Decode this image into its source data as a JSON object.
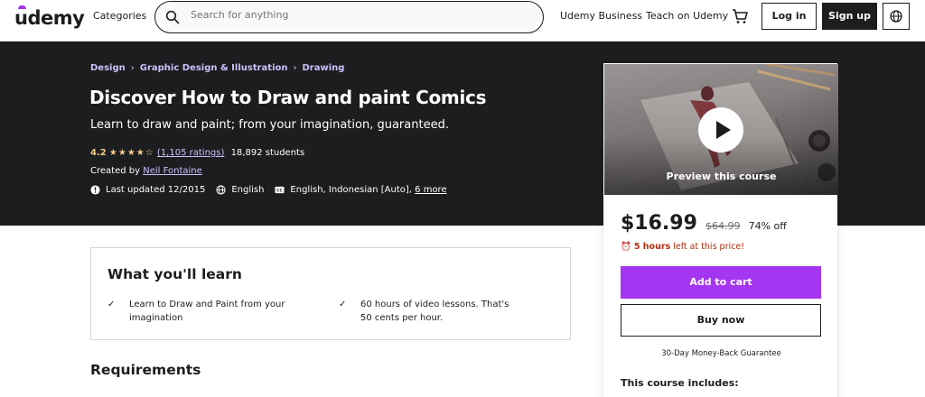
{
  "header": {
    "logo": "udemy",
    "categories": "Categories",
    "search_placeholder": "Search for anything",
    "business": "Udemy Business",
    "teach": "Teach on Udemy",
    "login": "Log in",
    "signup": "Sign up"
  },
  "breadcrumb": [
    "Design",
    "Graphic Design & Illustration",
    "Drawing"
  ],
  "course": {
    "title": "Discover How to Draw and paint Comics",
    "subtitle": "Learn to draw and paint; from your imagination, guaranteed.",
    "rating": "4.2",
    "stars": "★★★★☆",
    "ratings_count": "(1,105 ratings)",
    "students": "18,892 students",
    "created_by_label": "Created by",
    "instructor": "Neil Fontaine",
    "last_updated": "Last updated 12/2015",
    "language": "English",
    "captions": "English, Indonesian [Auto],",
    "more_captions": "6 more"
  },
  "card": {
    "preview_label": "Preview this course",
    "price": "$16.99",
    "original_price": "$64.99",
    "discount": "74% off",
    "timer_bold": "5 hours",
    "timer_rest": "left at this price!",
    "add_to_cart": "Add to cart",
    "buy_now": "Buy now",
    "guarantee": "30-Day Money-Back Guarantee",
    "includes_title": "This course includes:"
  },
  "learn": {
    "title": "What you'll learn",
    "items": [
      "Learn to Draw and Paint from your imagination",
      "60 hours of video lessons. That's 50 cents per hour."
    ]
  },
  "requirements": {
    "title": "Requirements"
  },
  "colors": {
    "brand_purple": "#a435f0",
    "hero_bg": "#1c1d1f",
    "link_purple": "#cec0fc",
    "star": "#f3ca8c",
    "timer_red": "#b32d0f"
  }
}
